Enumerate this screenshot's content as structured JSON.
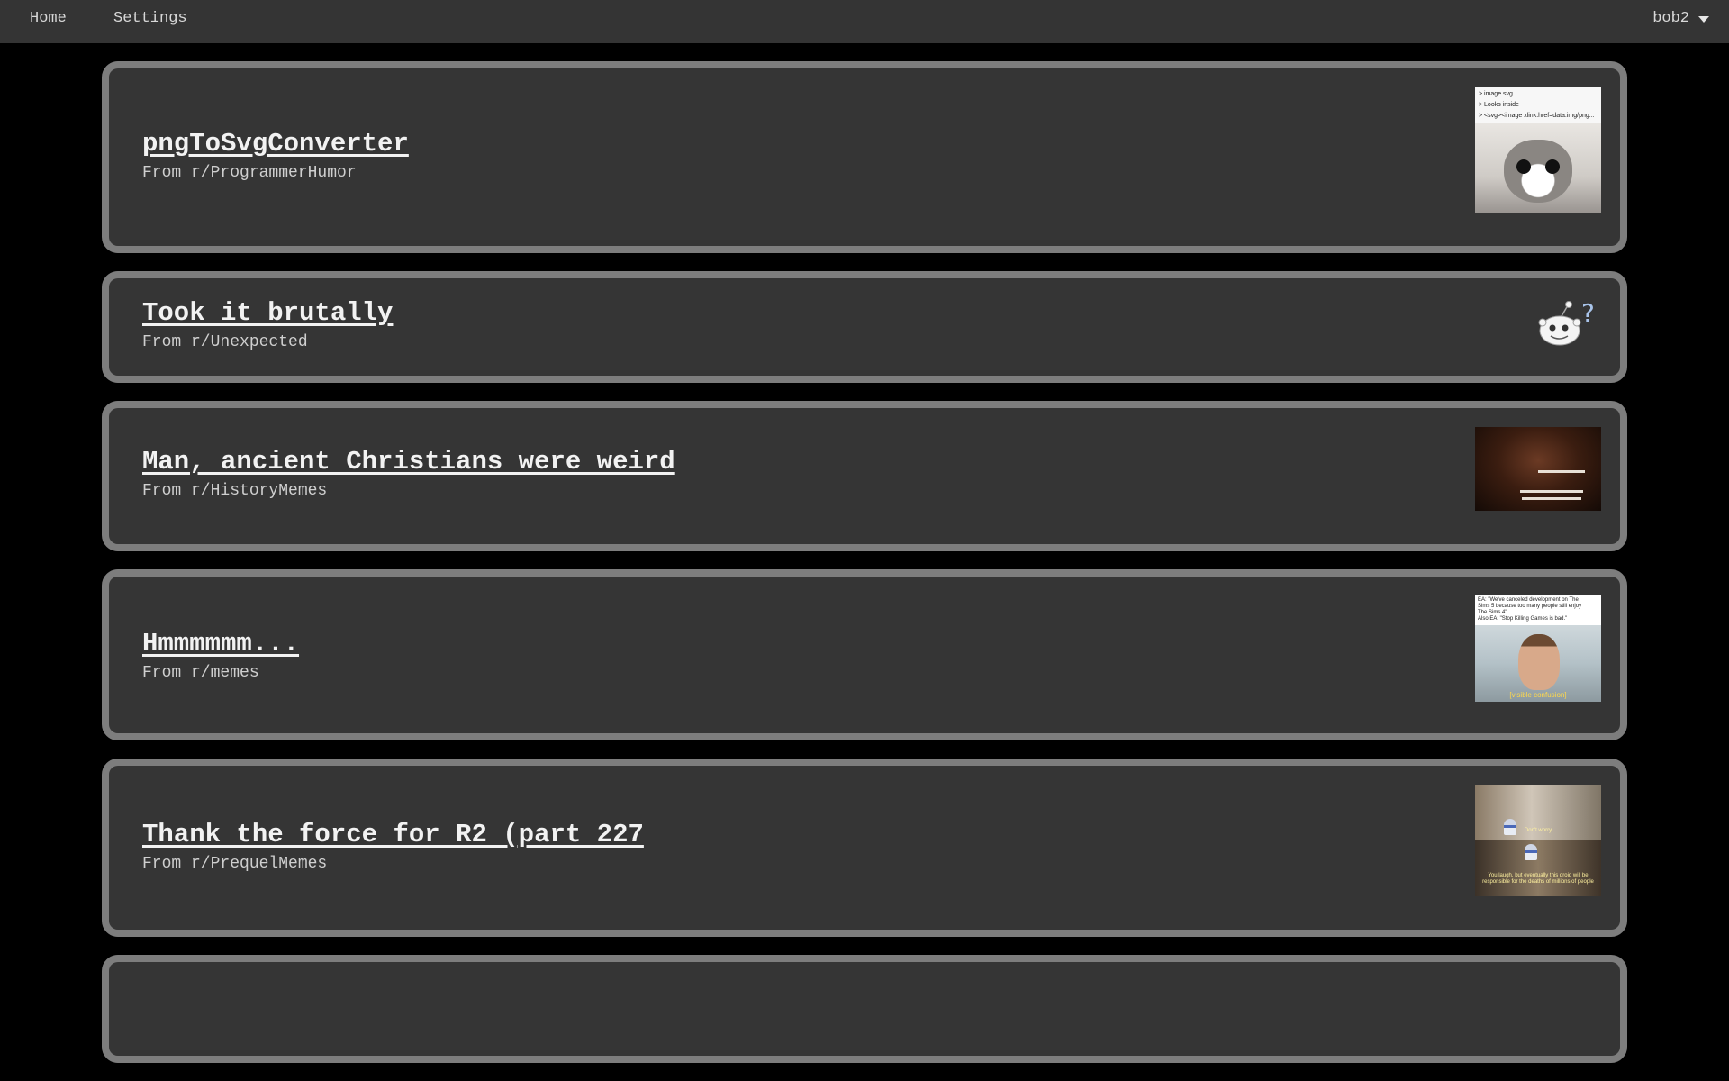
{
  "nav": {
    "home_label": "Home",
    "settings_label": "Settings",
    "username": "bob2"
  },
  "posts": [
    {
      "title": "pngToSvgConverter",
      "source": "From r/ProgrammerHumor",
      "thumbnail": {
        "kind": "image",
        "caption_lines": [
          "> image.svg",
          "> Looks inside",
          "> <svg><image xlink:href=data:img/png..."
        ]
      }
    },
    {
      "title": "Took it brutally",
      "source": "From r/Unexpected",
      "thumbnail": {
        "kind": "default-reddit-icon",
        "glyph": "?"
      }
    },
    {
      "title": "Man, ancient Christians were weird",
      "source": "From r/HistoryMemes",
      "thumbnail": {
        "kind": "image"
      }
    },
    {
      "title": "Hmmmmmm...",
      "source": "From r/memes",
      "thumbnail": {
        "kind": "image",
        "caption_lines": [
          "EA: \"We've canceled development on The",
          "Sims 5 because too many people still enjoy",
          "The Sims 4\"",
          "Also EA: \"Stop Killing Games is bad.\""
        ],
        "subtitle": "[visible confusion]"
      }
    },
    {
      "title": "Thank the force for R2 (part 227",
      "source": "From r/PrequelMemes",
      "thumbnail": {
        "kind": "image",
        "caption_top": "Don't worry",
        "caption_bottom": "You laugh, but eventually this droid will be responsible for the deaths of millions of people"
      }
    }
  ],
  "colors": {
    "page_background": "#000000",
    "topbar": "#343434",
    "card_background": "#353535",
    "card_border": "#7d7d7d",
    "text": "#f2f2f2"
  }
}
